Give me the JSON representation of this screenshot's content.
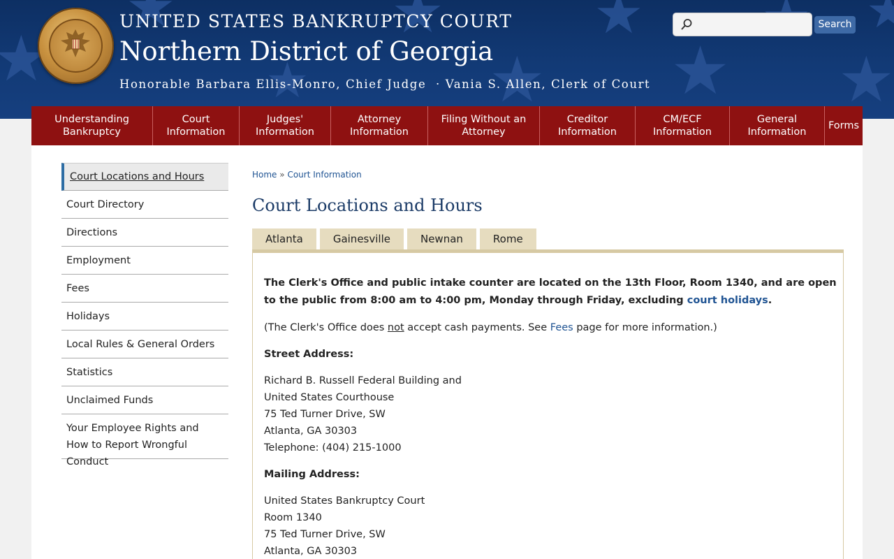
{
  "header": {
    "court_name": "UNITED STATES BANKRUPTCY COURT",
    "district": "Northern District of Georgia",
    "officials": "Honorable Barbara Ellis-Monro, Chief Judge  · Vania S. Allen, Clerk of Court",
    "seal_name": "court-seal",
    "search": {
      "placeholder": "",
      "value": "",
      "button_label": "Search"
    }
  },
  "nav": {
    "items": [
      {
        "label": "Understanding\nBankruptcy"
      },
      {
        "label": "Court\nInformation"
      },
      {
        "label": "Judges'\nInformation"
      },
      {
        "label": "Attorney\nInformation"
      },
      {
        "label": "Filing Without an\nAttorney"
      },
      {
        "label": "Creditor\nInformation"
      },
      {
        "label": "CM/ECF\nInformation"
      },
      {
        "label": "General\nInformation"
      },
      {
        "label": "Forms"
      }
    ]
  },
  "sidebar": {
    "items": [
      {
        "label": "Court Locations and Hours",
        "active": true
      },
      {
        "label": "Court Directory"
      },
      {
        "label": "Directions"
      },
      {
        "label": "Employment"
      },
      {
        "label": "Fees"
      },
      {
        "label": "Holidays"
      },
      {
        "label": "Local Rules & General Orders"
      },
      {
        "label": "Statistics"
      },
      {
        "label": "Unclaimed Funds"
      },
      {
        "label": "Your Employee Rights and How to Report Wrongful Conduct"
      }
    ]
  },
  "breadcrumb": {
    "home": "Home",
    "separator": "»",
    "current": "Court Information"
  },
  "page_title": "Court Locations and Hours",
  "tabs": [
    {
      "label": "Atlanta",
      "active": true
    },
    {
      "label": "Gainesville"
    },
    {
      "label": "Newnan"
    },
    {
      "label": "Rome"
    }
  ],
  "panel": {
    "intro_text": "The Clerk's Office and public intake counter are located on the 13th Floor, Room 1340, and are open to the public from 8:00 am to 4:00 pm, Monday through Friday, excluding ",
    "intro_link": "court holidays",
    "intro_end": ".",
    "note_start": "(The Clerk's Office does ",
    "note_not": "not",
    "note_mid": " accept cash payments. See ",
    "note_link": "Fees",
    "note_end": " page for more information.)",
    "street_heading": "Street Address:",
    "street_lines": [
      "Richard B. Russell Federal Building and",
      "United States Courthouse",
      "75 Ted Turner Drive, SW",
      "Atlanta, GA 30303",
      "Telephone: (404) 215-1000"
    ],
    "mailing_heading": "Mailing Address:",
    "mailing_lines": [
      "United States Bankruptcy Court",
      "Room 1340",
      "75 Ted Turner Drive, SW",
      "Atlanta, GA 30303"
    ]
  },
  "colors": {
    "banner": "#123a76",
    "nav": "#8e1111",
    "link": "#205493",
    "tab": "#e6dcbf"
  }
}
